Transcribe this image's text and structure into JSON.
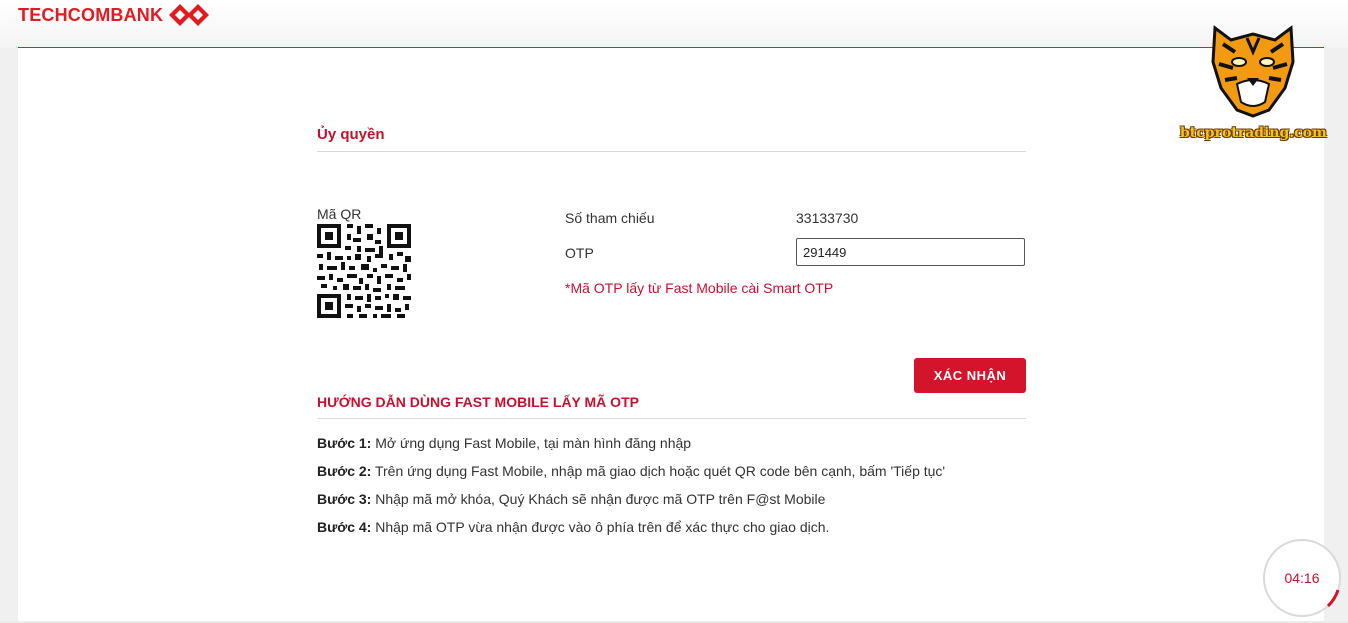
{
  "brand": {
    "name": "TECHCOMBANK",
    "color": "#e11b22"
  },
  "auth": {
    "title": "Ủy quyền",
    "qr_label": "Mã QR",
    "ref_label": "Số tham chiếu",
    "ref_value": "33133730",
    "otp_label": "OTP",
    "otp_value": "291449",
    "otp_note": "*Mã OTP lấy từ Fast Mobile cài Smart OTP",
    "confirm_label": "XÁC NHẬN"
  },
  "guide": {
    "title": "HƯỚNG DẪN DÙNG FAST MOBILE LẤY MÃ OTP",
    "steps": [
      {
        "label": "Bước 1:",
        "text": " Mở ứng dụng Fast Mobile, tại màn hình đăng nhập"
      },
      {
        "label": "Bước 2:",
        "text": " Trên ứng dụng Fast Mobile, nhập mã giao dịch hoặc quét QR code bên cạnh, bấm 'Tiếp tục'"
      },
      {
        "label": "Bước 3:",
        "text": " Nhập mã mở khóa, Quý Khách sẽ nhận được mã OTP trên F@st Mobile"
      },
      {
        "label": "Bước 4:",
        "text": " Nhập mã OTP vừa nhận được vào ô phía trên để xác thực cho giao dịch."
      }
    ]
  },
  "watermark": {
    "text": "btcprotrading.com",
    "icon": "tiger-head-icon"
  },
  "timer": {
    "value": "04:16",
    "accent": "#c8102e"
  }
}
